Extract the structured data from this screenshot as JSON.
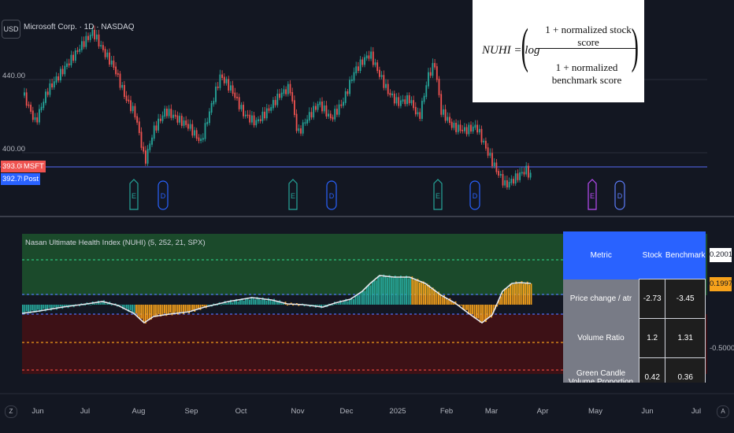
{
  "header": {
    "currency": "USD",
    "symbol_title": "Microsoft Corp. · 1D · NASDAQ"
  },
  "price_axis": {
    "label_high": "440.00",
    "label_low": "400.00"
  },
  "badges": {
    "last_price": "393.08",
    "ticker": "MSFT",
    "post_price": "392.75",
    "post_label": "Post"
  },
  "events": [
    {
      "letter": "E",
      "kind": "earnings"
    },
    {
      "letter": "D",
      "kind": "dividend"
    },
    {
      "letter": "E",
      "kind": "earnings"
    },
    {
      "letter": "D",
      "kind": "dividend"
    },
    {
      "letter": "E",
      "kind": "earnings"
    },
    {
      "letter": "D",
      "kind": "dividend"
    },
    {
      "letter": "E",
      "kind": "earnings-upcoming"
    },
    {
      "letter": "D",
      "kind": "dividend-upcoming"
    }
  ],
  "formula": {
    "lhs": "NUHI = log",
    "numerator": "1 + normalized stock score",
    "denominator": "1 + normalized benchmark score"
  },
  "indicator": {
    "title": "Nasan Ultimate Health Index (NUHI) (5, 252, 21, SPX)",
    "value_1": "0.2001",
    "value_2": "0.1997",
    "level_label": "-0.5000"
  },
  "metrics_table": {
    "headers": [
      "Metric",
      "Stock",
      "Benchmark"
    ],
    "rows": [
      {
        "metric": "Price change / atr",
        "stock": "-2.73",
        "benchmark": "-3.45"
      },
      {
        "metric": "Volume Ratio",
        "stock": "1.2",
        "benchmark": "1.31"
      },
      {
        "metric": "Green Candle Volume Proportion",
        "stock": "0.42",
        "benchmark": "0.36"
      }
    ]
  },
  "time_axis": [
    "Jun",
    "Jul",
    "Aug",
    "Sep",
    "Oct",
    "Nov",
    "Dec",
    "2025",
    "Feb",
    "Mar",
    "Apr",
    "May",
    "Jun",
    "Jul"
  ],
  "nav": {
    "left": "Z",
    "right": "A"
  },
  "colors": {
    "up": "#26a69a",
    "down": "#ef5350",
    "accent": "#2962ff",
    "histogram_orange": "#f7a21b",
    "zone_green": "#1b4a2b",
    "zone_red": "#3d1116"
  }
}
